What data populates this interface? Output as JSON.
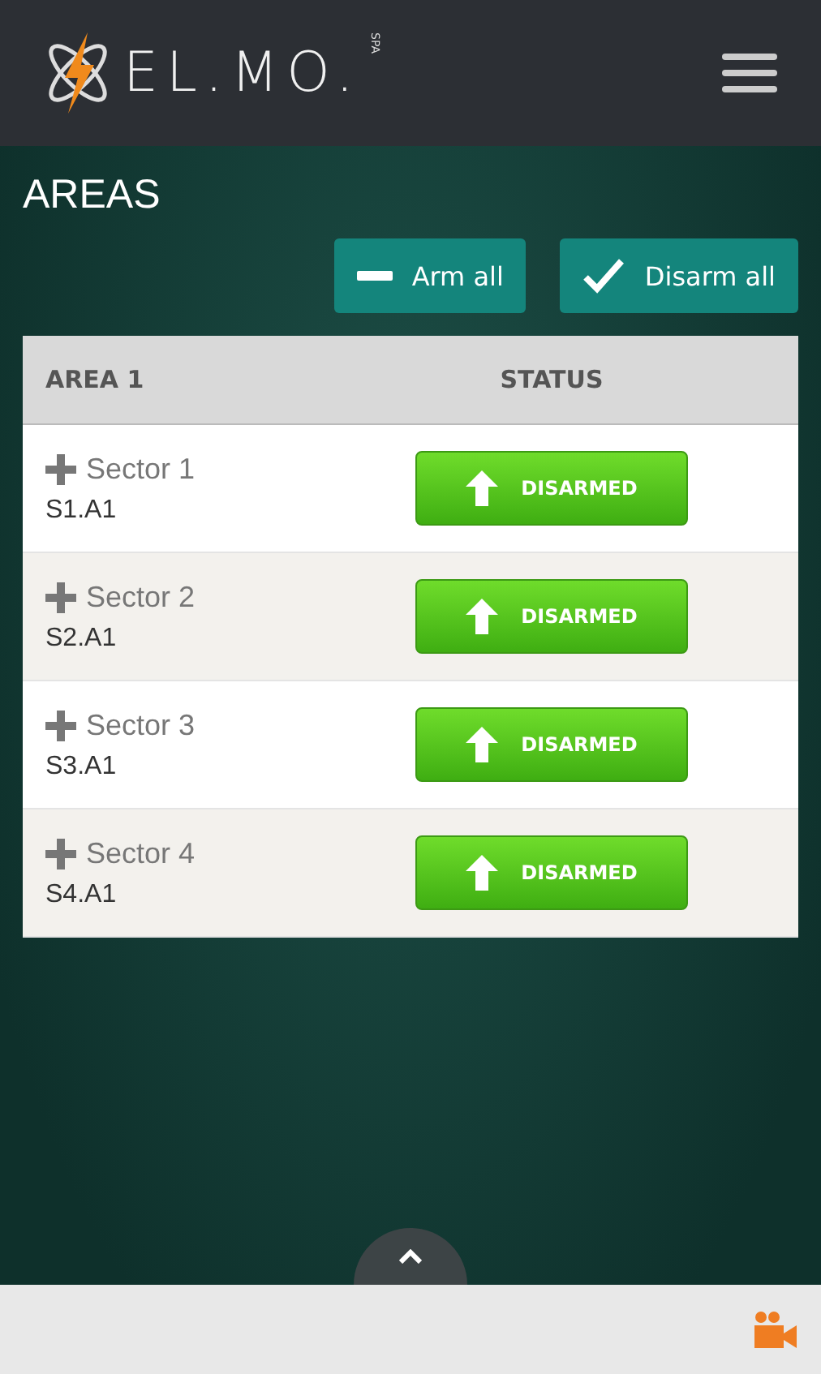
{
  "header": {
    "logo_text": "EL.MO.",
    "logo_suffix": "SPA"
  },
  "page_title": "AREAS",
  "actions": [
    {
      "kind": "arm",
      "label": "Arm all"
    },
    {
      "kind": "disarm",
      "label": "Disarm all"
    }
  ],
  "table": {
    "columns": [
      "AREA 1",
      "STATUS"
    ],
    "rows": [
      {
        "name": "Sector 1",
        "code": "S1.A1",
        "status": {
          "kind": "disarmed",
          "label": "DISARMED"
        }
      },
      {
        "name": "Sector 2",
        "code": "S2.A1",
        "status": {
          "kind": "disarmed",
          "label": "DISARMED"
        }
      },
      {
        "name": "Sector 3",
        "code": "S3.A1",
        "status": {
          "kind": "disarmed",
          "label": "DISARMED"
        }
      },
      {
        "name": "Sector 4",
        "code": "S4.A1",
        "status": {
          "kind": "disarmed",
          "label": "DISARMED"
        }
      }
    ]
  }
}
